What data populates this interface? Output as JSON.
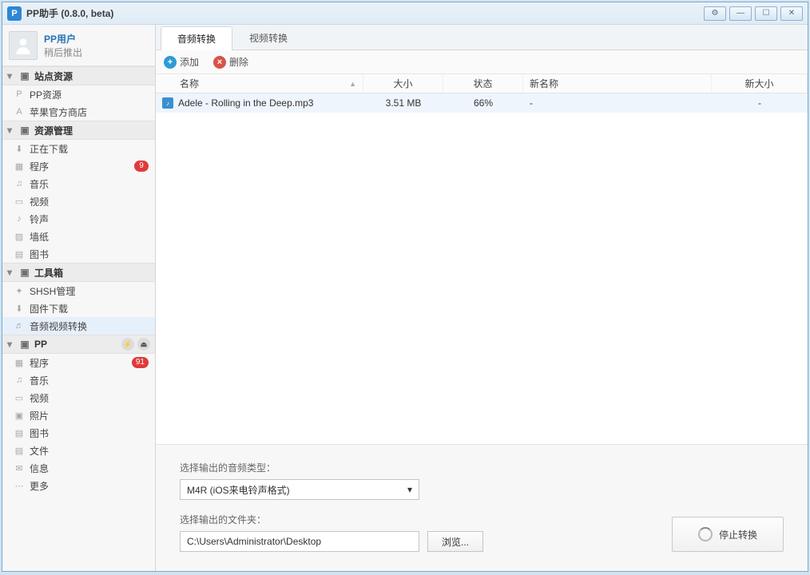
{
  "window": {
    "title": "PP助手 (0.8.0, beta)"
  },
  "user": {
    "name": "PP用户",
    "sub": "稍后推出"
  },
  "sidebar": {
    "sections": [
      {
        "label": "站点资源",
        "items": [
          {
            "label": "PP资源",
            "icon": "pp"
          },
          {
            "label": "苹果官方商店",
            "icon": "appstore"
          }
        ]
      },
      {
        "label": "资源管理",
        "items": [
          {
            "label": "正在下载",
            "icon": "download"
          },
          {
            "label": "程序",
            "icon": "app",
            "badge": "9"
          },
          {
            "label": "音乐",
            "icon": "music"
          },
          {
            "label": "视频",
            "icon": "video"
          },
          {
            "label": "铃声",
            "icon": "ringtone"
          },
          {
            "label": "墙纸",
            "icon": "wallpaper"
          },
          {
            "label": "图书",
            "icon": "book"
          }
        ]
      },
      {
        "label": "工具箱",
        "items": [
          {
            "label": "SHSH管理",
            "icon": "shsh"
          },
          {
            "label": "固件下载",
            "icon": "firmware"
          },
          {
            "label": "音频视频转换",
            "icon": "convert",
            "selected": true
          }
        ]
      },
      {
        "label": "PP",
        "rightIcons": true,
        "items": [
          {
            "label": "程序",
            "icon": "app",
            "badge": "91"
          },
          {
            "label": "音乐",
            "icon": "music"
          },
          {
            "label": "视频",
            "icon": "video"
          },
          {
            "label": "照片",
            "icon": "photo"
          },
          {
            "label": "图书",
            "icon": "book"
          },
          {
            "label": "文件",
            "icon": "file"
          },
          {
            "label": "信息",
            "icon": "info"
          },
          {
            "label": "更多",
            "icon": "more"
          }
        ]
      }
    ]
  },
  "tabs": {
    "audio": "音频转换",
    "video": "视频转换"
  },
  "toolbar": {
    "add": "添加",
    "del": "删除"
  },
  "grid": {
    "headers": {
      "name": "名称",
      "size": "大小",
      "status": "状态",
      "newname": "新名称",
      "newsize": "新大小"
    },
    "rows": [
      {
        "name": "Adele - Rolling in the Deep.mp3",
        "size": "3.51 MB",
        "status": "66%",
        "newname": "-",
        "newsize": "-"
      }
    ]
  },
  "bottom": {
    "typeLabel": "选择输出的音频类型：",
    "typeValue": "M4R (iOS来电铃声格式)",
    "folderLabel": "选择输出的文件夹：",
    "folderValue": "C:\\Users\\Administrator\\Desktop",
    "browse": "浏览...",
    "stop": "停止转换"
  }
}
